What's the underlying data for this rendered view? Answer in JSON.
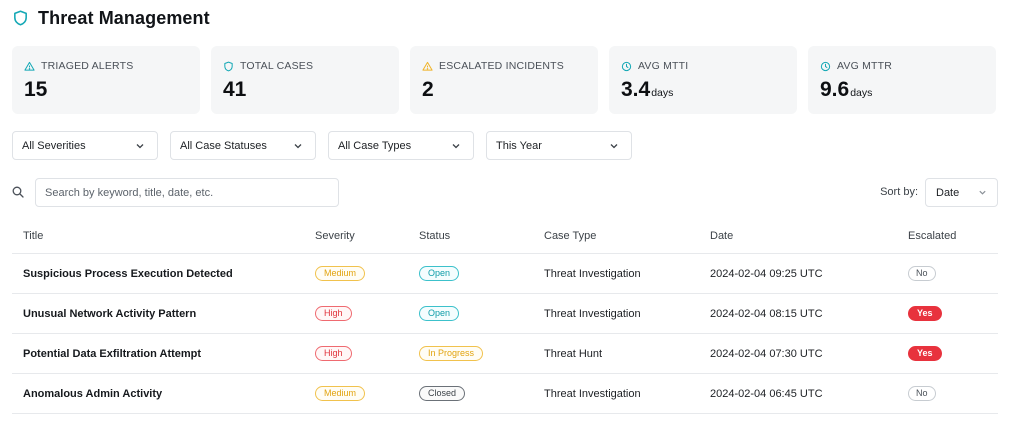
{
  "header": {
    "title": "Threat Management",
    "icon": "shield-icon",
    "accent": "#14a8b5"
  },
  "stats": [
    {
      "label": "TRIAGED ALERTS",
      "value": "15",
      "unit": "",
      "icon": "alert-triangle-icon"
    },
    {
      "label": "TOTAL CASES",
      "value": "41",
      "unit": "",
      "icon": "shield-icon"
    },
    {
      "label": "ESCALATED INCIDENTS",
      "value": "2",
      "unit": "",
      "icon": "warning-icon"
    },
    {
      "label": "AVG MTTI",
      "value": "3.4",
      "unit": "days",
      "icon": "clock-icon"
    },
    {
      "label": "AVG MTTR",
      "value": "9.6",
      "unit": "days",
      "icon": "clock-icon"
    }
  ],
  "filters": {
    "severity": "All Severities",
    "status": "All Case Statuses",
    "type": "All Case Types",
    "period": "This Year"
  },
  "search": {
    "placeholder": "Search by keyword, title, date, etc."
  },
  "sort": {
    "label": "Sort by:",
    "value": "Date"
  },
  "table": {
    "headers": [
      "Title",
      "Severity",
      "Status",
      "Case Type",
      "Date",
      "Escalated"
    ],
    "rows": [
      {
        "title": "Suspicious Process Execution Detected",
        "severity": "Medium",
        "status": "Open",
        "case_type": "Threat Investigation",
        "date": "2024-02-04 09:25 UTC",
        "escalated": "No"
      },
      {
        "title": "Unusual Network Activity Pattern",
        "severity": "High",
        "status": "Open",
        "case_type": "Threat Investigation",
        "date": "2024-02-04 08:15 UTC",
        "escalated": "Yes"
      },
      {
        "title": "Potential Data Exfiltration Attempt",
        "severity": "High",
        "status": "In Progress",
        "case_type": "Threat Hunt",
        "date": "2024-02-04 07:30 UTC",
        "escalated": "Yes"
      },
      {
        "title": "Anomalous Admin Activity",
        "severity": "Medium",
        "status": "Closed",
        "case_type": "Threat Investigation",
        "date": "2024-02-04 06:45 UTC",
        "escalated": "No"
      }
    ]
  },
  "colors": {
    "medium": "#e2a40f",
    "high": "#e0323b",
    "open": "#0f9da8",
    "closed": "#3c4248",
    "yes": "#e8323d"
  }
}
